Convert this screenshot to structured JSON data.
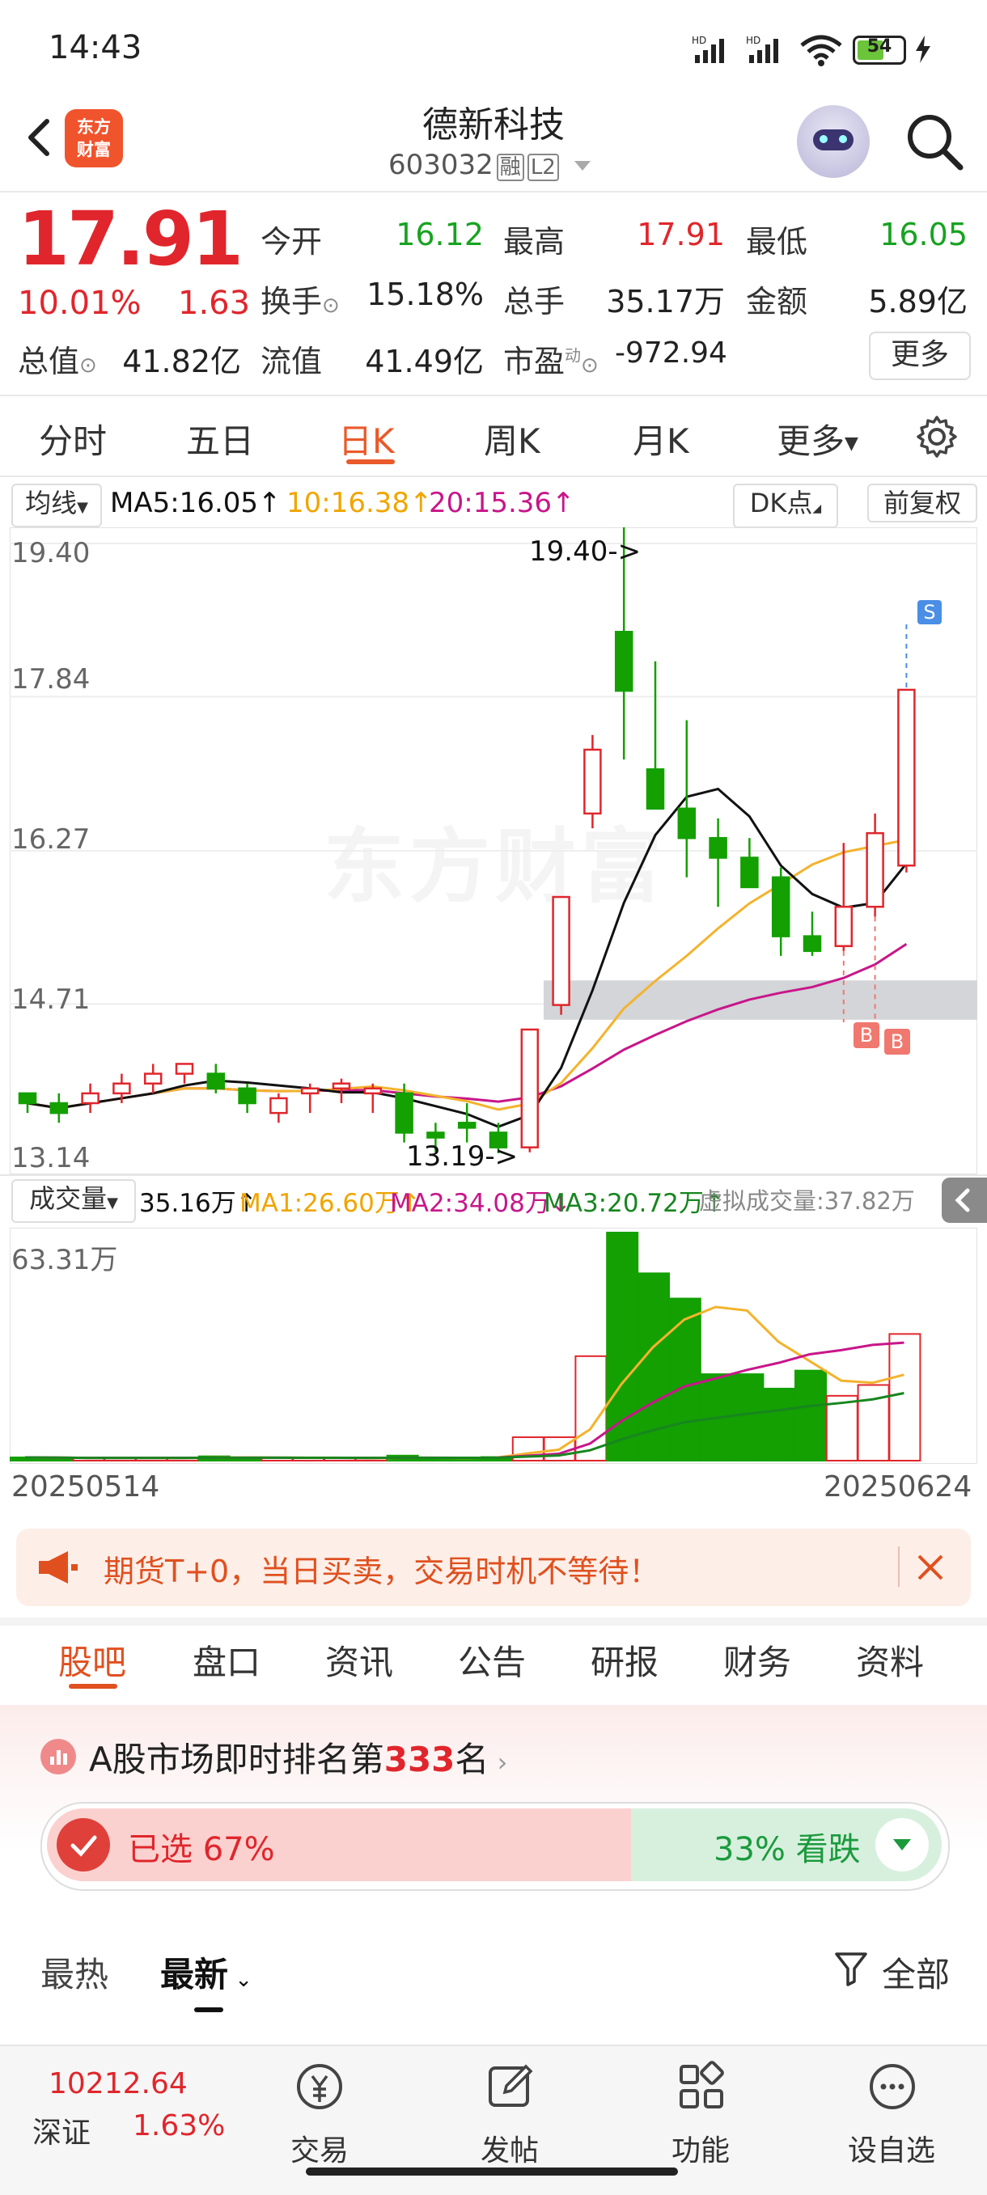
{
  "status_bar": {
    "time": "14:43",
    "battery": "54",
    "hd1": "HD",
    "hd2": "HD"
  },
  "header": {
    "logo_line1": "东方",
    "logo_line2": "财富",
    "name": "德新科技",
    "code": "603032",
    "tag_margin": "融",
    "tag_level": "L2"
  },
  "quote": {
    "price": "17.91",
    "pct": "10.01%",
    "change": "1.63",
    "rows": [
      {
        "label": "今开",
        "value": "16.12",
        "color": "green"
      },
      {
        "label": "最高",
        "value": "17.91",
        "color": "red"
      },
      {
        "label": "最低",
        "value": "16.05",
        "color": "green"
      },
      {
        "label": "换手",
        "value": "15.18%",
        "color": "plain"
      },
      {
        "label": "总手",
        "value": "35.17万",
        "color": "plain"
      },
      {
        "label": "金额",
        "value": "5.89亿",
        "color": "plain"
      },
      {
        "label": "总值",
        "value": "41.82亿",
        "color": "plain"
      },
      {
        "label": "流值",
        "value": "41.49亿",
        "color": "plain"
      },
      {
        "label": "市盈",
        "value": "-972.94",
        "color": "plain",
        "sup": "动"
      }
    ],
    "more": "更多"
  },
  "period_tabs": [
    "分时",
    "五日",
    "日K",
    "周K",
    "月K",
    "更多"
  ],
  "ma_bar": {
    "selector": "均线",
    "ma5": "MA5:16.05",
    "ma10": "10:16.38",
    "ma20": "20:15.36",
    "dk": "DK点",
    "adjust": "前复权"
  },
  "kline": {
    "y_labels": [
      "19.40",
      "17.84",
      "16.27",
      "14.71",
      "13.14"
    ],
    "high_marker": "19.40->",
    "low_marker": "13.19->",
    "signal_s": "S",
    "signal_b": "B",
    "watermark": "东方财富"
  },
  "volume_bar": {
    "selector": "成交量",
    "vol": "35.16万",
    "ma1": "MA1:26.60万",
    "ma2": "MA2:34.08万",
    "ma3": "MA3:20.72万",
    "virtual": "虚拟成交量:37.82万",
    "max_label": "63.31万"
  },
  "dates": {
    "start": "20250514",
    "end": "20250624"
  },
  "chart_data": {
    "type": "candlestick",
    "title": "",
    "dates_range": [
      "20250514",
      "20250624"
    ],
    "ylim": [
      13.14,
      19.4
    ],
    "candles": [
      {
        "o": 13.8,
        "h": 13.8,
        "l": 13.6,
        "c": 13.7,
        "v": 0.9
      },
      {
        "o": 13.7,
        "h": 13.8,
        "l": 13.5,
        "c": 13.6,
        "v": 0.8
      },
      {
        "o": 13.7,
        "h": 13.9,
        "l": 13.6,
        "c": 13.8,
        "v": 0.6
      },
      {
        "o": 13.8,
        "h": 14.0,
        "l": 13.7,
        "c": 13.9,
        "v": 0.7
      },
      {
        "o": 13.9,
        "h": 14.1,
        "l": 13.8,
        "c": 14.0,
        "v": 0.8
      },
      {
        "o": 14.0,
        "h": 14.1,
        "l": 13.9,
        "c": 14.1,
        "v": 0.7
      },
      {
        "o": 14.0,
        "h": 14.1,
        "l": 13.8,
        "c": 13.85,
        "v": 1.2
      },
      {
        "o": 13.85,
        "h": 13.9,
        "l": 13.6,
        "c": 13.7,
        "v": 0.9
      },
      {
        "o": 13.6,
        "h": 13.8,
        "l": 13.5,
        "c": 13.75,
        "v": 0.6
      },
      {
        "o": 13.8,
        "h": 13.9,
        "l": 13.6,
        "c": 13.85,
        "v": 0.7
      },
      {
        "o": 13.85,
        "h": 13.95,
        "l": 13.7,
        "c": 13.9,
        "v": 0.6
      },
      {
        "o": 13.8,
        "h": 13.9,
        "l": 13.6,
        "c": 13.85,
        "v": 0.6
      },
      {
        "o": 13.8,
        "h": 13.9,
        "l": 13.3,
        "c": 13.4,
        "v": 1.4
      },
      {
        "o": 13.4,
        "h": 13.5,
        "l": 13.2,
        "c": 13.35,
        "v": 0.6
      },
      {
        "o": 13.5,
        "h": 13.7,
        "l": 13.3,
        "c": 13.45,
        "v": 0.5
      },
      {
        "o": 13.4,
        "h": 13.5,
        "l": 13.19,
        "c": 13.25,
        "v": 1.0
      },
      {
        "o": 13.25,
        "h": 14.45,
        "l": 13.2,
        "c": 14.45,
        "v": 6.5
      },
      {
        "o": 14.7,
        "h": 15.8,
        "l": 14.6,
        "c": 15.8,
        "v": 6.5
      },
      {
        "o": 16.65,
        "h": 17.45,
        "l": 16.5,
        "c": 17.3,
        "v": 29.0
      },
      {
        "o": 18.5,
        "h": 19.4,
        "l": 17.2,
        "c": 17.9,
        "v": 63.31
      },
      {
        "o": 17.1,
        "h": 18.2,
        "l": 16.9,
        "c": 16.7,
        "v": 52.0
      },
      {
        "o": 16.7,
        "h": 17.6,
        "l": 16.0,
        "c": 16.4,
        "v": 45.0
      },
      {
        "o": 16.4,
        "h": 16.6,
        "l": 15.7,
        "c": 16.2,
        "v": 24.0
      },
      {
        "o": 16.2,
        "h": 16.4,
        "l": 15.9,
        "c": 15.9,
        "v": 24.0
      },
      {
        "o": 16.0,
        "h": 16.1,
        "l": 15.2,
        "c": 15.4,
        "v": 20.0
      },
      {
        "o": 15.4,
        "h": 15.65,
        "l": 15.2,
        "c": 15.25,
        "v": 25.0
      },
      {
        "o": 15.3,
        "h": 16.35,
        "l": 15.25,
        "c": 15.7,
        "v": 18.0
      },
      {
        "o": 15.7,
        "h": 16.65,
        "l": 15.6,
        "c": 16.45,
        "v": 21.0
      },
      {
        "o": 16.12,
        "h": 17.91,
        "l": 16.05,
        "c": 17.91,
        "v": 35.16
      }
    ],
    "colors": {
      "up": "#e0262c",
      "down": "#13a000",
      "ma5": "#111111",
      "ma10": "#f3b32c",
      "ma20": "#c8168a"
    }
  },
  "banner": {
    "text": "期货T+0，当日买卖，交易时机不等待！"
  },
  "section_tabs": [
    "股吧",
    "盘口",
    "资讯",
    "公告",
    "研报",
    "财务",
    "资料"
  ],
  "ranking": {
    "prefix": "A股市场即时排名第",
    "rank": "333",
    "suffix": "名"
  },
  "vote": {
    "up": "已选 67%",
    "up_value": 67,
    "down": "33% 看跌"
  },
  "sort": {
    "hot": "最热",
    "latest": "最新",
    "filter": "全部"
  },
  "bottom_nav": {
    "index_value": "10212.64",
    "index_name": "深证",
    "index_pct": "1.63%",
    "trade": "交易",
    "post": "发帖",
    "func": "功能",
    "watch": "设自选"
  }
}
